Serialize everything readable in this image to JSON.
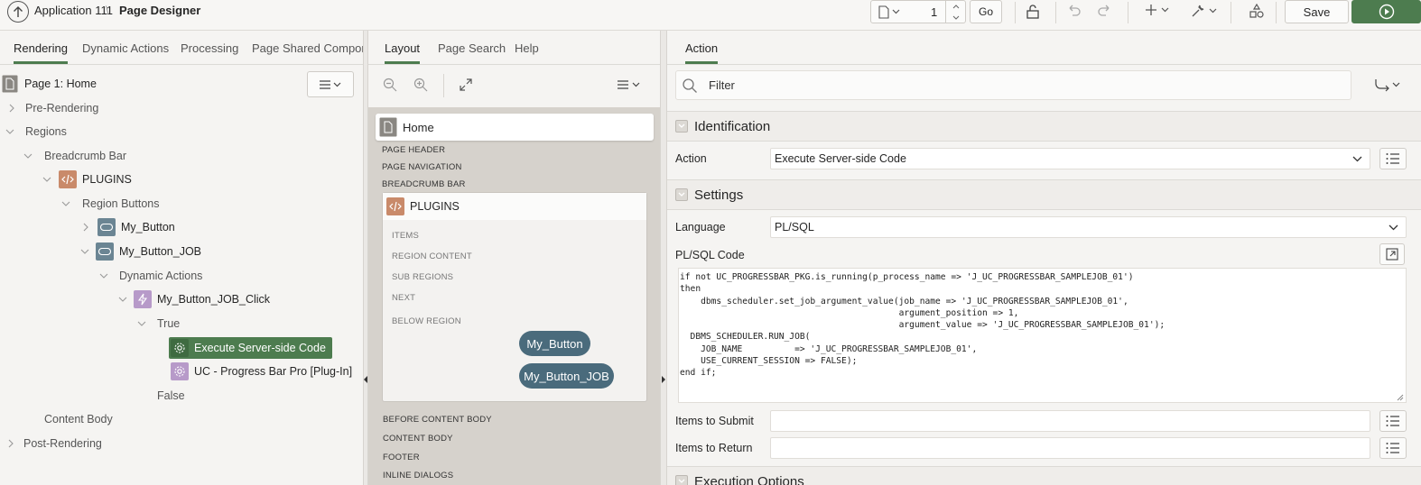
{
  "header": {
    "app_name": "Application 111",
    "separator": "\\",
    "page_designer": "Page Designer",
    "page_number": "1",
    "go_label": "Go",
    "save_label": "Save"
  },
  "left": {
    "tabs": [
      "Rendering",
      "Dynamic Actions",
      "Processing",
      "Page Shared Componen"
    ],
    "page_title": "Page 1: Home",
    "tree": {
      "pre_rendering": "Pre-Rendering",
      "regions": "Regions",
      "breadcrumb_bar": "Breadcrumb Bar",
      "plugins": "PLUGINS",
      "region_buttons": "Region Buttons",
      "my_button": "My_Button",
      "my_button_job": "My_Button_JOB",
      "dynamic_actions": "Dynamic Actions",
      "click": "My_Button_JOB_Click",
      "true": "True",
      "exec_code": "Execute Server-side Code",
      "plugin": "UC - Progress Bar Pro [Plug-In]",
      "false": "False",
      "content_body": "Content Body",
      "post_rendering": "Post-Rendering"
    }
  },
  "middle": {
    "tabs": [
      "Layout",
      "Page Search",
      "Help"
    ],
    "home": "Home",
    "page_header": "PAGE HEADER",
    "page_navigation": "PAGE NAVIGATION",
    "breadcrumb_bar": "BREADCRUMB BAR",
    "plugins": "PLUGINS",
    "items": "ITEMS",
    "region_content": "REGION CONTENT",
    "sub_regions": "SUB REGIONS",
    "next": "NEXT",
    "below_region": "BELOW REGION",
    "btn1": "My_Button",
    "btn2": "My_Button_JOB",
    "before_content_body": "BEFORE CONTENT BODY",
    "content_body": "CONTENT BODY",
    "footer": "FOOTER",
    "inline_dialogs": "INLINE DIALOGS"
  },
  "right": {
    "tab": "Action",
    "filter_placeholder": "Filter",
    "identification": "Identification",
    "action_label": "Action",
    "action_value": "Execute Server-side Code",
    "settings": "Settings",
    "language_label": "Language",
    "language_value": "PL/SQL",
    "plsql_label": "PL/SQL Code",
    "code": "if not UC_PROGRESSBAR_PKG.is_running(p_process_name => 'J_UC_PROGRESSBAR_SAMPLEJOB_01')\nthen\n    dbms_scheduler.set_job_argument_value(job_name => 'J_UC_PROGRESSBAR_SAMPLEJOB_01',\n                                          argument_position => 1,\n                                          argument_value => 'J_UC_PROGRESSBAR_SAMPLEJOB_01');\n  DBMS_SCHEDULER.RUN_JOB(\n    JOB_NAME          => 'J_UC_PROGRESSBAR_SAMPLEJOB_01',\n    USE_CURRENT_SESSION => FALSE);\nend if;",
    "items_submit_label": "Items to Submit",
    "items_return_label": "Items to Return",
    "execution_options": "Execution Options"
  },
  "colors": {
    "accent_green": "#4d7c4f",
    "button_slate": "#4a6b7c",
    "code_icon": "#c98a6a",
    "da_icon": "#b79ac9"
  }
}
